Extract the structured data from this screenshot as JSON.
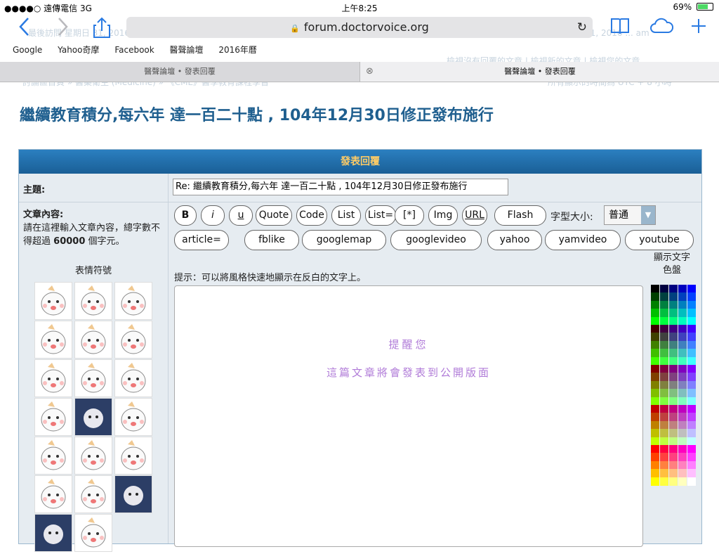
{
  "status": {
    "carrier": "●●●●○ 遠傳電信  3G",
    "time": "上午8:25",
    "battery": "69%",
    "battery_level": 0.69,
    "battery_color": "#4cd964"
  },
  "browser": {
    "url": "forum.doctorvoice.org",
    "back_icon": "chevron-left-icon",
    "bookmarks": [
      "Google",
      "Yahoo奇摩",
      "Facebook",
      "醫聲論壇",
      "2016年曆"
    ],
    "tabs": [
      {
        "label": "醫聲論壇 • 發表回覆"
      },
      {
        "label": "醫聲論壇 • 發表回覆"
      }
    ],
    "accent": "#2a7ae2"
  },
  "ghost": {
    "date_text": "最後訪問 星期日 31, 2016 8:55 pm",
    "now_text": "現在的時間是 週一 5月 01, 2016 ... am",
    "links1": "檢視沒有回覆的文章 | 檢視新的文章 | 檢視您的文章",
    "breadcrumb": "討論區首頁 » 醫藥衛生 (Medicine) » 《CME》醫學教育課程學習",
    "tz": "所有顯示的時間為 UTC + 8 小時"
  },
  "page": {
    "title": "繼續教育積分,每六年 達一百二十點 , 104年12月30日修正發布施行"
  },
  "form": {
    "header": "發表回覆",
    "subject_label": "主題:",
    "subject_value": "Re: 繼續教育積分,每六年 達一百二十點 , 104年12月30日修正發布施行",
    "body_label": "文章內容:",
    "body_hint_pre": "請在這裡輸入文章內容，總字數不得超過",
    "body_hint_num": "60000",
    "body_hint_post": "個字元。",
    "smilies_title": "表情符號",
    "font_size_label": "字型大小:",
    "font_size_value": "普通",
    "tip": "提示：可以將風格快速地顯示在反白的文字上。",
    "placeholder_line1": "提醒您",
    "placeholder_line2": "這篇文章將會發表到公開版面",
    "palette_label": "顯示文字\n色盤",
    "buttons_row1": [
      "B",
      "i",
      "u",
      "Quote",
      "Code",
      "List",
      "List=",
      "[*]",
      "Img",
      "URL",
      "Flash"
    ],
    "buttons_row2": [
      "article=",
      "fblike",
      "googlemap",
      "googlevideo",
      "yahoo",
      "yamvideo",
      "youtube"
    ]
  }
}
